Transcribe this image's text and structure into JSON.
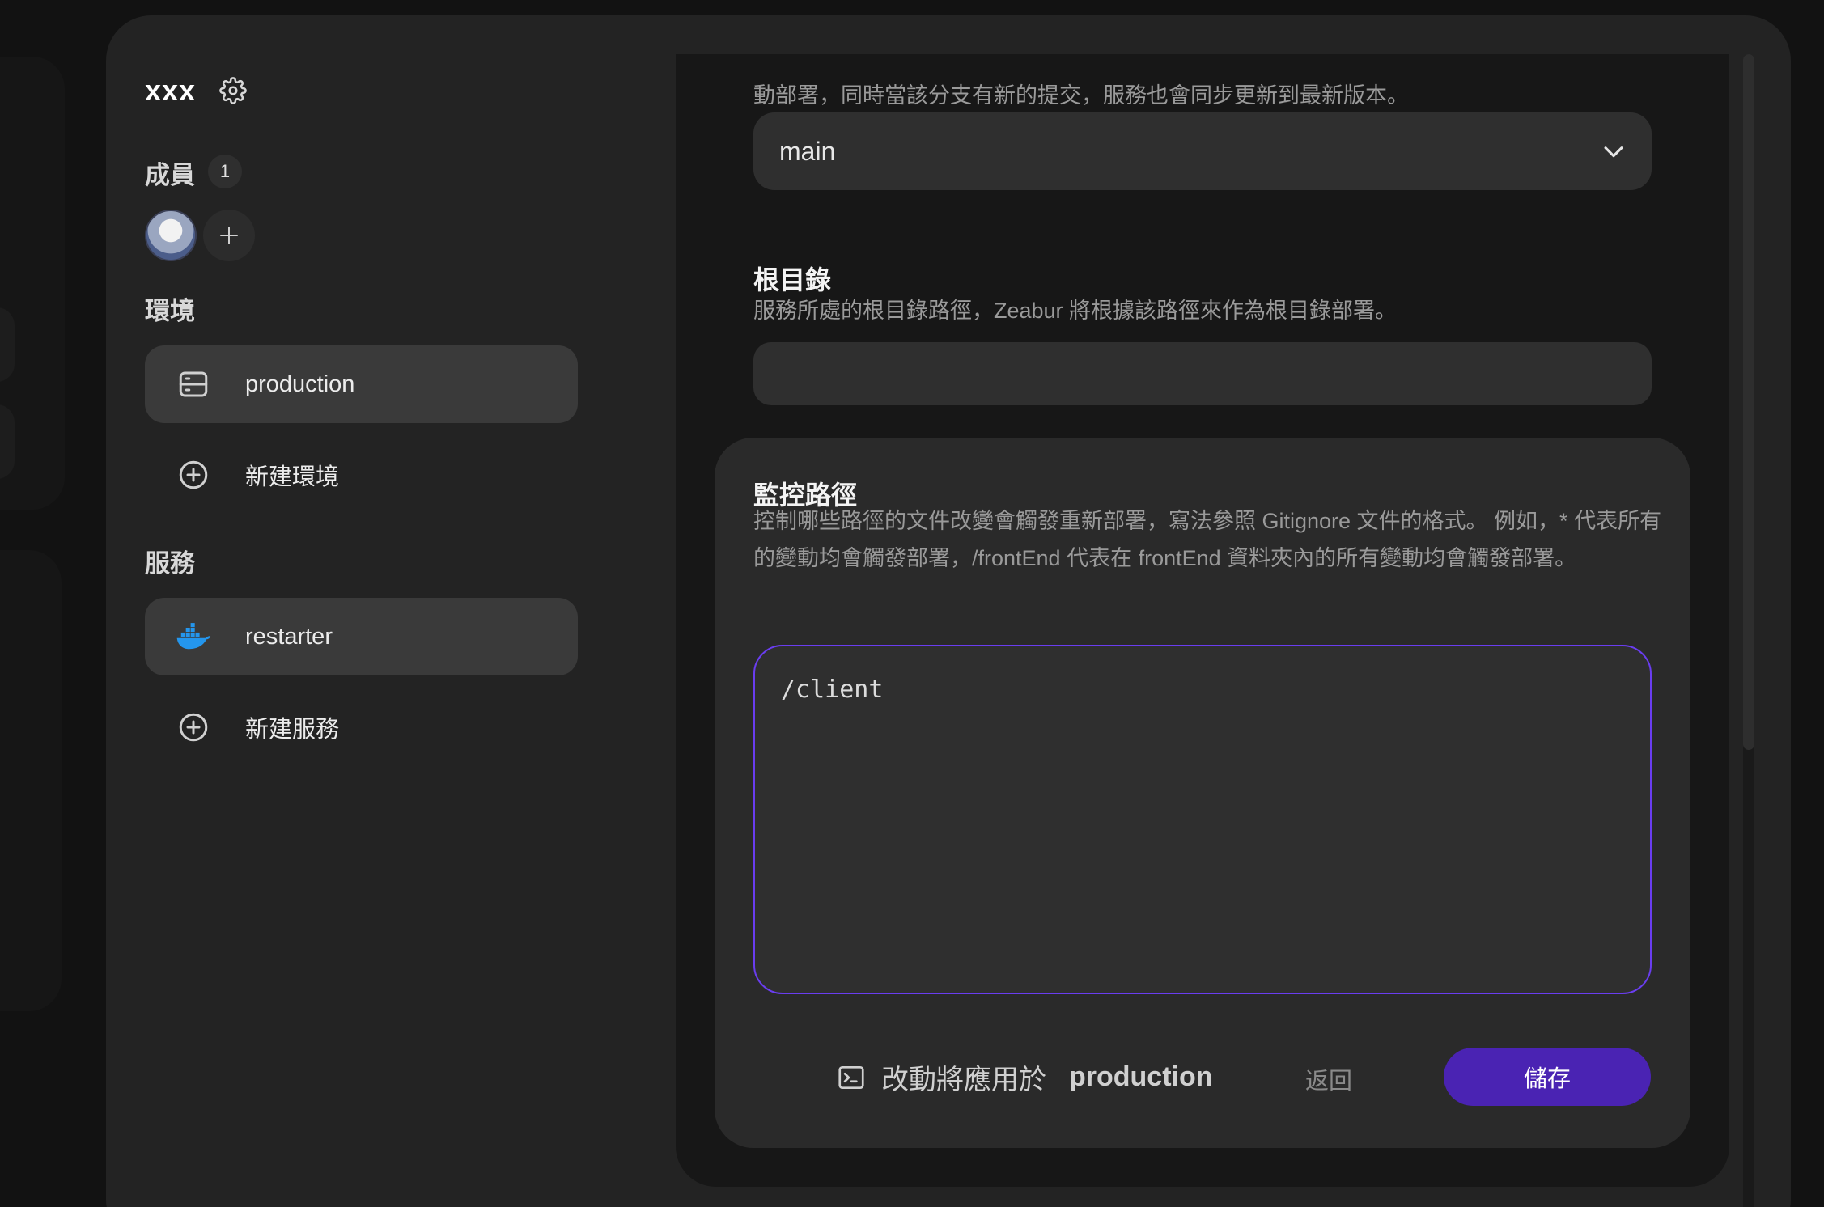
{
  "sidebar": {
    "project_name": "xxx",
    "members": {
      "title": "成員",
      "count": "1"
    },
    "environments": {
      "title": "環境",
      "items": [
        {
          "label": "production",
          "icon": "server-icon",
          "active": true
        },
        {
          "label": "新建環境",
          "icon": "plus-circle-icon",
          "active": false
        }
      ]
    },
    "services": {
      "title": "服務",
      "items": [
        {
          "label": "restarter",
          "icon": "docker-icon",
          "active": true
        },
        {
          "label": "新建服務",
          "icon": "plus-circle-icon",
          "active": false
        }
      ]
    }
  },
  "main": {
    "branch": {
      "description_tail": "動部署，同時當該分支有新的提交，服務也會同步更新到最新版本。",
      "selected": "main"
    },
    "root_dir": {
      "title": "根目錄",
      "description": "服務所處的根目錄路徑，Zeabur 將根據該路徑來作為根目錄部署。",
      "value": ""
    },
    "watch_paths": {
      "title": "監控路徑",
      "description": "控制哪些路徑的文件改變會觸發重新部署，寫法參照 Gitignore 文件的格式。 例如，* 代表所有的變動均會觸發部署，/frontEnd 代表在 frontEnd 資料夾內的所有變動均會觸發部署。",
      "value": "/client"
    },
    "footer": {
      "apply_text": "改動將應用於",
      "apply_env": "production",
      "back_label": "返回",
      "save_label": "儲存"
    }
  },
  "colors": {
    "accent": "#4a23b3",
    "focus_border": "#6a3df0",
    "docker_blue": "#2496ed"
  }
}
